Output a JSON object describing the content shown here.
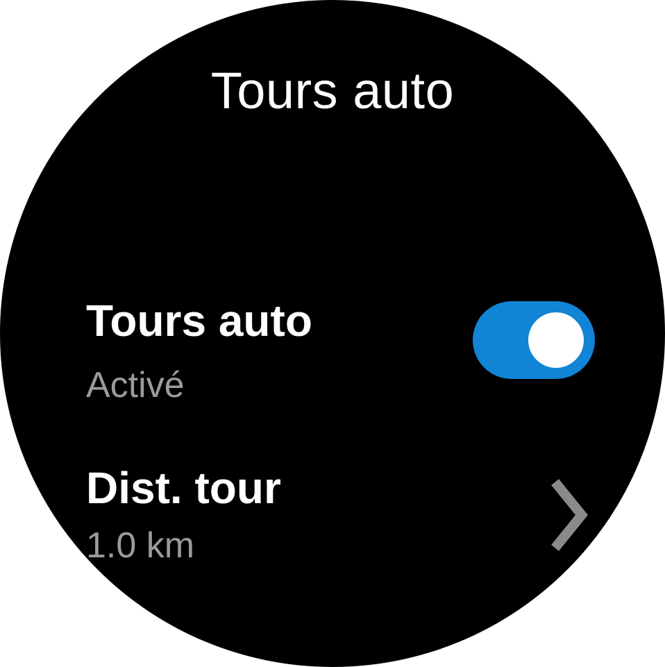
{
  "colors": {
    "background": "#000000",
    "primary_text": "#ffffff",
    "secondary_text": "#9b9b9b",
    "toggle_on": "#1184d6",
    "chevron": "#8a8a8a"
  },
  "header": {
    "title": "Tours auto"
  },
  "settings": {
    "auto_laps": {
      "label": "Tours auto",
      "status": "Activé",
      "enabled": true,
      "icon": "toggle-switch"
    },
    "lap_distance": {
      "label": "Dist. tour",
      "value": "1.0 km",
      "icon": "chevron-right-icon"
    }
  }
}
